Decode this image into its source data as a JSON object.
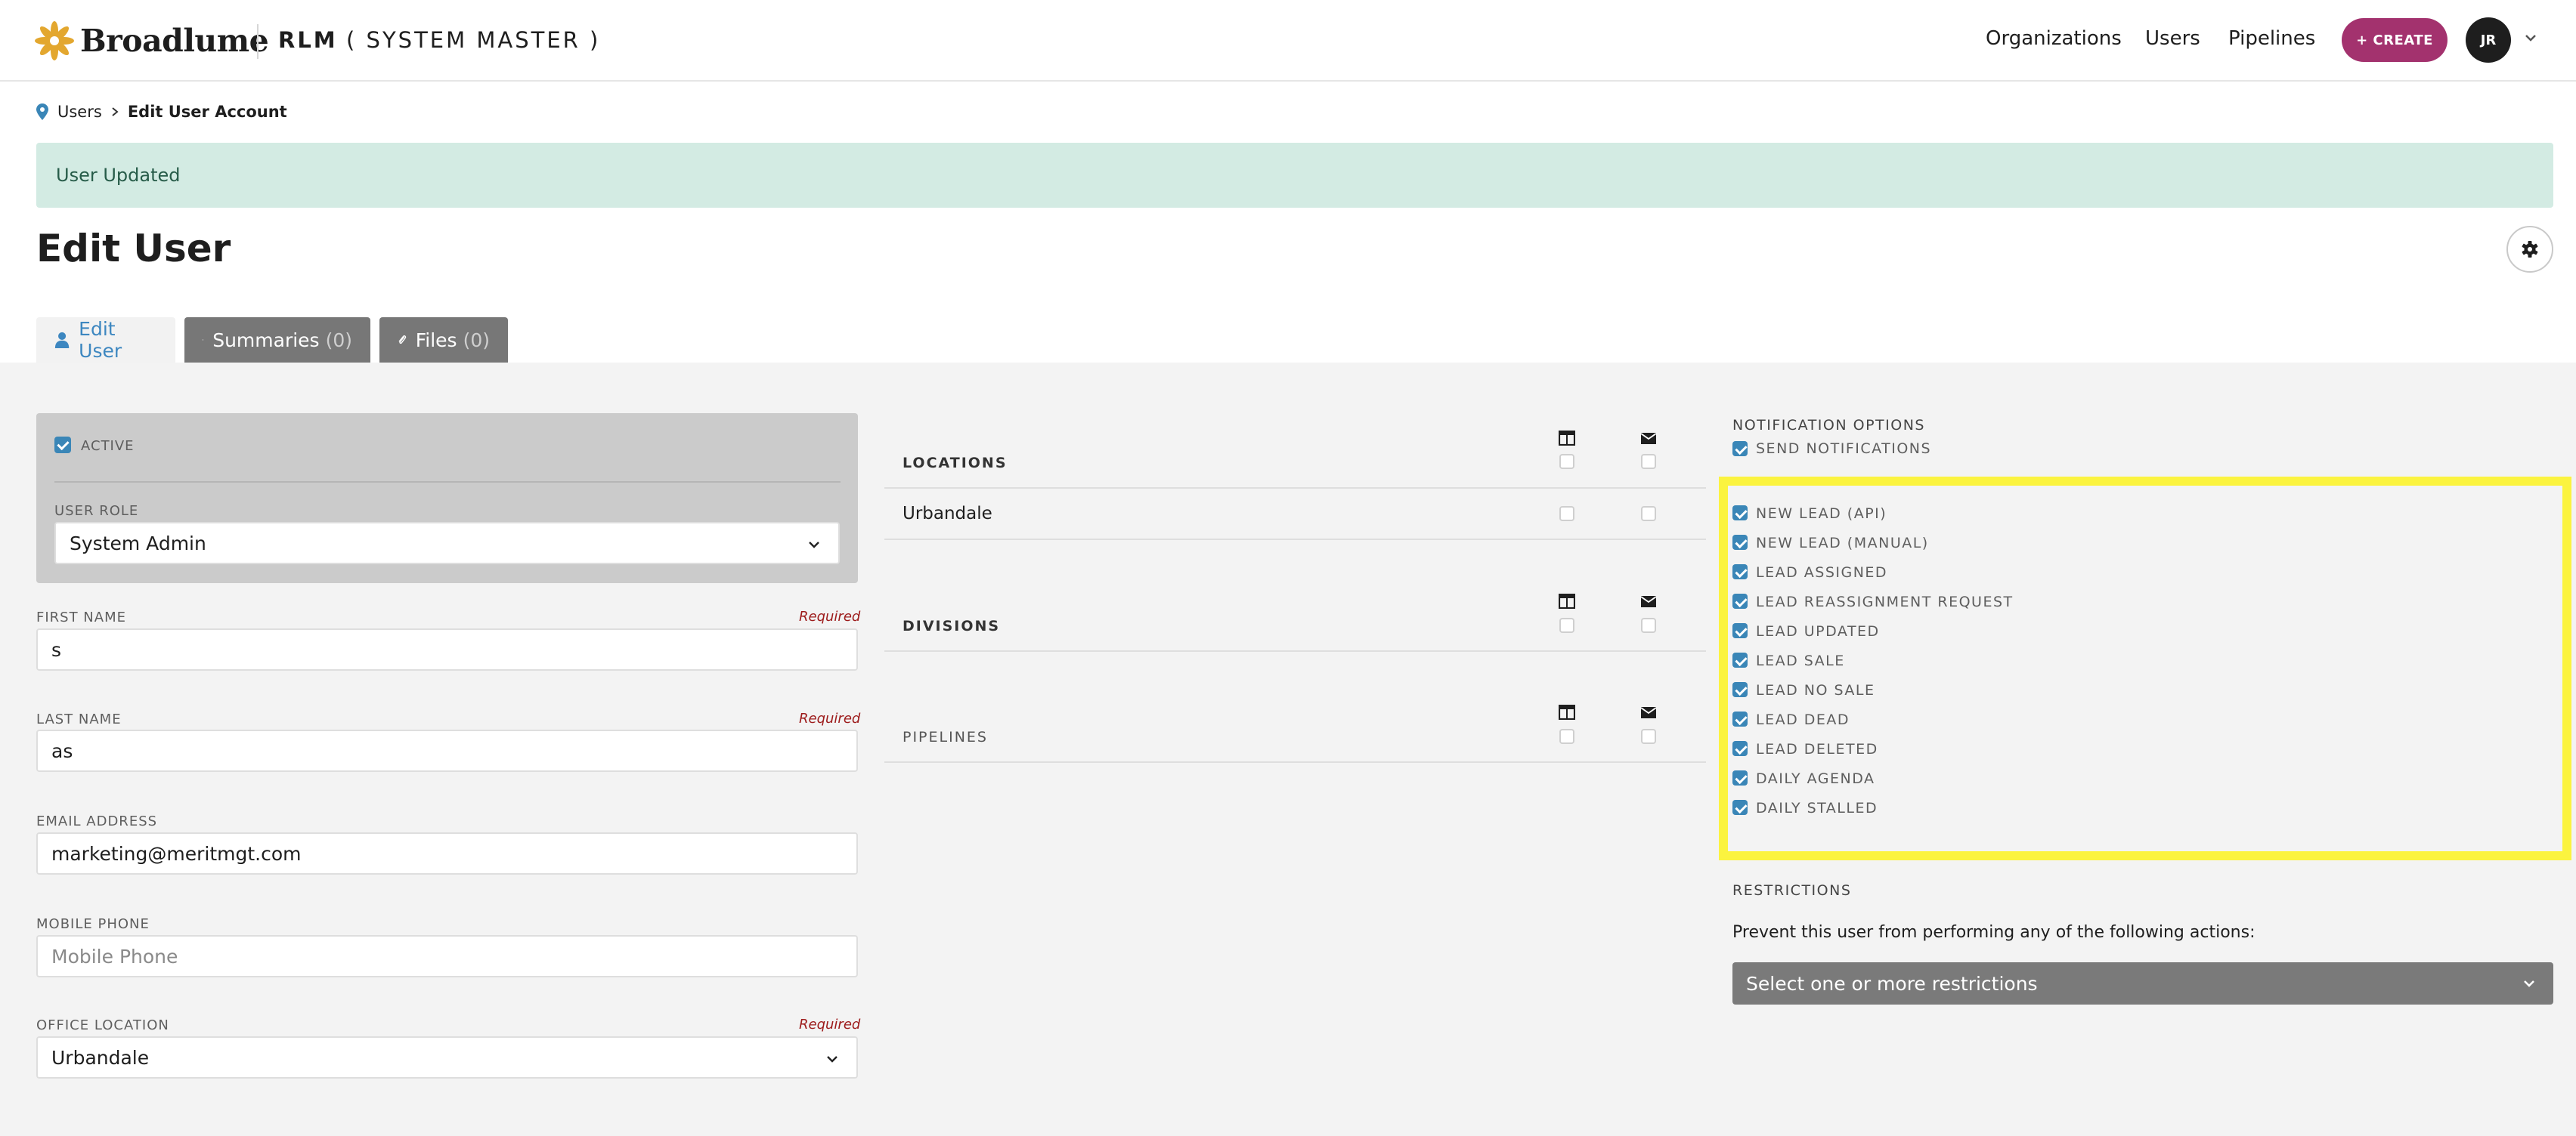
{
  "header": {
    "brand": "Broadlume",
    "app_name": "RLM",
    "app_sub": "( SYSTEM MASTER )",
    "nav": [
      "Organizations",
      "Users",
      "Pipelines"
    ],
    "create_label": "+ CREATE",
    "avatar_initials": "JR"
  },
  "breadcrumb": {
    "parent": "Users",
    "current": "Edit User Account"
  },
  "alert": {
    "message": "User Updated"
  },
  "page_title": "Edit User",
  "tabs": [
    {
      "label": "Edit User",
      "count": ""
    },
    {
      "label": "Summaries",
      "count": "(0)"
    },
    {
      "label": "Files",
      "count": "(0)"
    }
  ],
  "form": {
    "active_label": "ACTIVE",
    "active_checked": true,
    "user_role_label": "USER ROLE",
    "user_role_value": "System Admin",
    "required_label": "Required",
    "first_name_label": "FIRST NAME",
    "first_name_value": "s",
    "last_name_label": "LAST NAME",
    "last_name_value": "as",
    "email_label": "EMAIL ADDRESS",
    "email_value": "marketing@meritmgt.com",
    "mobile_label": "MOBILE PHONE",
    "mobile_placeholder": "Mobile Phone",
    "office_label": "OFFICE LOCATION",
    "office_value": "Urbandale"
  },
  "assignments": {
    "locations_label": "LOCATIONS",
    "location_rows": [
      "Urbandale"
    ],
    "divisions_label": "DIVISIONS",
    "pipelines_label": "PIPELINES"
  },
  "notifications": {
    "title": "NOTIFICATION OPTIONS",
    "send_label": "SEND NOTIFICATIONS",
    "items": [
      "NEW LEAD (API)",
      "NEW LEAD (MANUAL)",
      "LEAD ASSIGNED",
      "LEAD REASSIGNMENT REQUEST",
      "LEAD UPDATED",
      "LEAD SALE",
      "LEAD NO SALE",
      "LEAD DEAD",
      "LEAD DELETED",
      "DAILY AGENDA",
      "DAILY STALLED"
    ]
  },
  "restrictions": {
    "title": "RESTRICTIONS",
    "help": "Prevent this user from performing any of the following actions:",
    "placeholder": "Select one or more restrictions"
  },
  "colors": {
    "accent_pink": "#a3326e",
    "checkbox_blue": "#3a86b7",
    "alert_bg": "#d3ebe3",
    "highlight_yellow": "#fbf33f"
  }
}
